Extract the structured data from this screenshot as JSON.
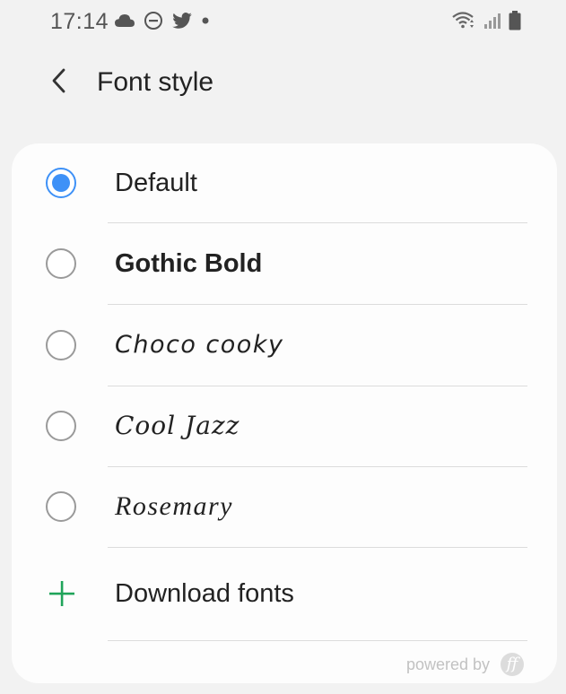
{
  "status_bar": {
    "time": "17:14",
    "left_icons": [
      "cloud-icon",
      "dnd-icon",
      "twitter-icon",
      "dot-icon"
    ],
    "right_icons": [
      "wifi-icon",
      "signal-icon",
      "battery-icon"
    ]
  },
  "header": {
    "title": "Font style",
    "back_icon": "back-arrow-icon"
  },
  "font_options": [
    {
      "label": "Default",
      "selected": true
    },
    {
      "label": "Gothic Bold",
      "selected": false
    },
    {
      "label": "Choco cooky",
      "selected": false
    },
    {
      "label": "Cool Jazz",
      "selected": false
    },
    {
      "label": "Rosemary",
      "selected": false
    }
  ],
  "download": {
    "label": "Download fonts",
    "icon": "plus-icon"
  },
  "footer": {
    "powered_by": "powered by",
    "logo_text": "ff"
  },
  "colors": {
    "accent": "#3e91f7",
    "plus": "#20a45a",
    "background": "#f2f2f2",
    "card": "#fdfdfd"
  }
}
